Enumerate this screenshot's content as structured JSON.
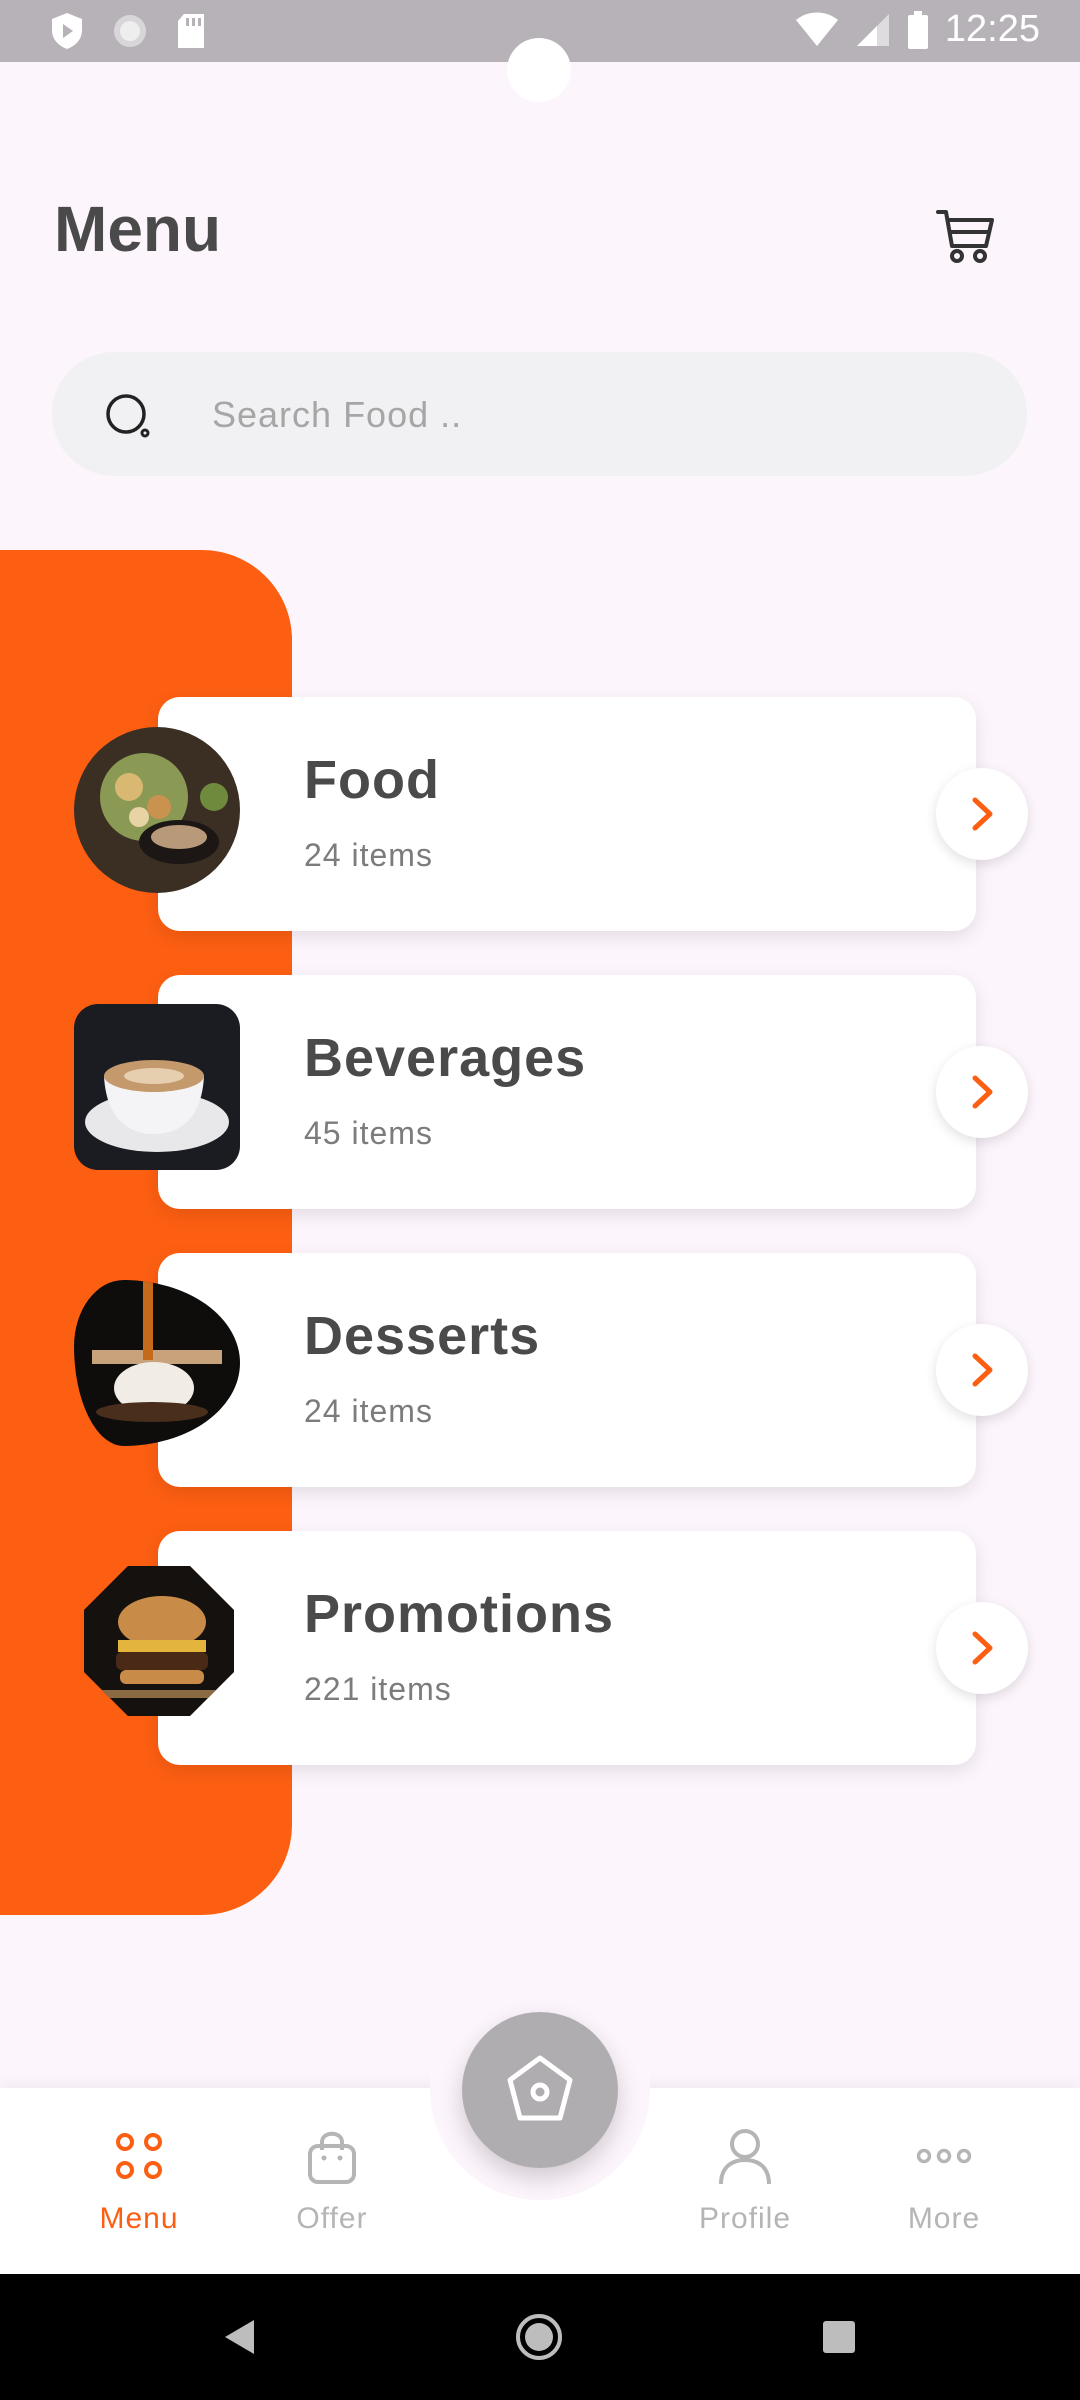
{
  "status_bar": {
    "time": "12:25"
  },
  "header": {
    "title": "Menu"
  },
  "search": {
    "placeholder": "Search Food .."
  },
  "categories": [
    {
      "name": "Food",
      "count": "24 items"
    },
    {
      "name": "Beverages",
      "count": "45 items"
    },
    {
      "name": "Desserts",
      "count": "24 items"
    },
    {
      "name": "Promotions",
      "count": "221 items"
    }
  ],
  "bottom_nav": {
    "items": [
      {
        "label": "Menu",
        "icon": "grid-dots-icon",
        "active": true
      },
      {
        "label": "Offer",
        "icon": "shopping-bag-icon",
        "active": false
      },
      {
        "label": "Profile",
        "icon": "user-icon",
        "active": false
      },
      {
        "label": "More",
        "icon": "more-dots-icon",
        "active": false
      }
    ],
    "center_icon": "home-icon"
  },
  "colors": {
    "accent": "#fd5f12",
    "background": "#fdf5fc",
    "text": "#4a4a4a",
    "inactive": "#b5b5b5"
  }
}
